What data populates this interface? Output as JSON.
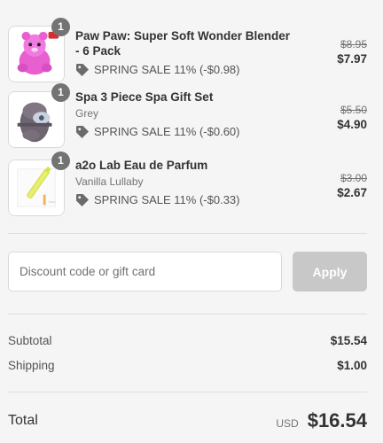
{
  "items": [
    {
      "name": "Paw Paw: Super Soft Wonder Blender - 6 Pack",
      "variant": "",
      "quantity": "1",
      "discount": "SPRING SALE 11% (-$0.98)",
      "compare_price": "$8.95",
      "price": "$7.97",
      "image_icon": "plush-toy-icon"
    },
    {
      "name": "Spa 3 Piece Spa Gift Set",
      "variant": "Grey",
      "quantity": "1",
      "discount": "SPRING SALE 11% (-$0.60)",
      "compare_price": "$5.50",
      "price": "$4.90",
      "image_icon": "spa-set-icon"
    },
    {
      "name": "a2o Lab Eau de Parfum",
      "variant": "Vanilla Lullaby",
      "quantity": "1",
      "discount": "SPRING SALE 11% (-$0.33)",
      "compare_price": "$3.00",
      "price": "$2.67",
      "image_icon": "perfume-icon"
    }
  ],
  "discount_code": {
    "placeholder": "Discount code or gift card",
    "value": "",
    "apply_label": "Apply"
  },
  "summary": {
    "subtotal_label": "Subtotal",
    "subtotal_value": "$15.54",
    "shipping_label": "Shipping",
    "shipping_value": "$1.00",
    "total_label": "Total",
    "currency": "USD",
    "total_value": "$16.54"
  },
  "colors": {
    "background": "#f5f5f5",
    "qty_badge": "#737373",
    "apply_disabled": "#c8c8c8"
  }
}
